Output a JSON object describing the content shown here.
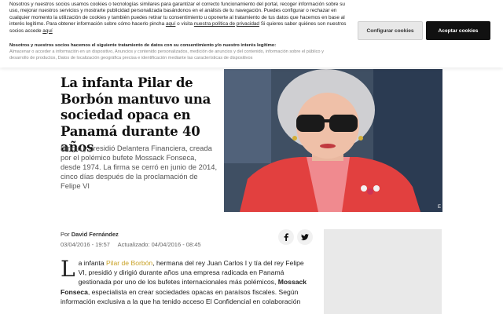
{
  "cookie_banner": {
    "intro_line1": "Nosotros y nuestros socios usamos cookies o tecnologías similares para garantizar el correcto funcionamiento del portal, recoger información",
    "intro_line2": "sobre su uso, mejorar nuestros servicios y mostrarte publicidad personalizada basándonos en el análisis de tu navegación.",
    "intro_line3": "Puedes configurar o rechazar en cualquier momento la utilización de cookies y también puedes retirar tu consentimiento u oponerte al tratamiento",
    "intro_line4a": "de tus datos que hacemos en base al interés legítimo. Para obtener información sobre cómo hacerlo pincha",
    "link_here_1": "aquí",
    "intro_line4b": "o visita",
    "link_privacy_1": "nuestra política de",
    "link_privacy_2": "privacidad",
    "intro_line5": "Si quieres saber quiénes son nuestros socios accede",
    "link_here_2": "aquí",
    "configure_label": "Configurar cookies",
    "accept_label": "Aceptar cookies",
    "legit_title": "Nosotros y nuestros socios hacemos el siguiente tratamiento de datos con su consentimiento y/o nuestro interés legítimo:",
    "legit_text": "Almacenar o acceder a información en un dispositivo, Anuncios y contenido personalizados, medición de anuncios y del contenido, información sobre el público y desarrollo de productos, Datos de localización geográfica precisa e identificación mediante las características de dispositivos"
  },
  "article": {
    "headline": "La infanta Pilar de Borbón mantuvo una sociedad opaca en Panamá durante 40 años",
    "subhead": "Dirigió y presidió Delantera Financiera, creada por el polémico bufete Mossack Fonseca, desde 1974. La firma se cerró en junio de 2014, cinco días después de la proclamación de Felipe VI",
    "photo_badge": "E",
    "byline_prefix": "Por",
    "author": "David Fernández",
    "published": "03/04/2016 - 19:57",
    "updated": "Actualizado: 04/04/2016 - 08:45",
    "dropcap": "L",
    "body_1": "a infanta ",
    "body_link": "Pilar de Borbón",
    "body_2": ", hermana del rey Juan Carlos I y tía del rey Felipe VI, presidió y dirigió durante años una empresa radicada en Panamá gestionada por uno de los bufetes internacionales más polémicos, ",
    "body_bold": "Mossack Fonseca",
    "body_3": ", especialista en crear sociedades opacas en paraísos fiscales. Según información exclusiva a la que ha tenido acceso El Confidencial en colaboración"
  },
  "social": {
    "facebook_icon": "facebook-icon",
    "twitter_icon": "twitter-icon"
  },
  "colors": {
    "accent_link": "#c9a227",
    "accept_bg": "#111111",
    "configure_bg": "#e8e8e8"
  }
}
